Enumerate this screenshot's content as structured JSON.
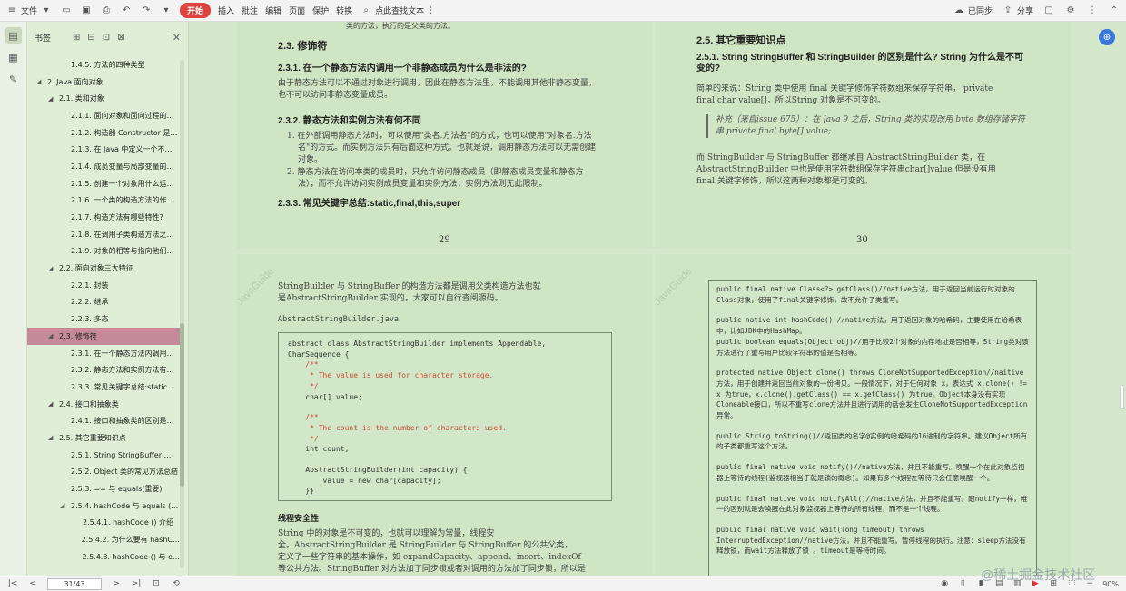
{
  "toolbar": {
    "file": "文件",
    "start": "开始",
    "menus": [
      "插入",
      "批注",
      "编辑",
      "页面",
      "保护",
      "转换"
    ],
    "search": "点此查找文本",
    "sync": "已同步",
    "share": "分享"
  },
  "panel": {
    "title": "书签",
    "items": [
      {
        "indent": 2,
        "arrow": "",
        "label": "1.4.5. 方法的四种类型"
      },
      {
        "indent": 0,
        "arrow": "◢",
        "label": "2. Java 面向对象"
      },
      {
        "indent": 1,
        "arrow": "◢",
        "label": "2.1. 类和对象"
      },
      {
        "indent": 2,
        "arrow": "",
        "label": "2.1.1. 面向对象和面向过程的…"
      },
      {
        "indent": 2,
        "arrow": "",
        "label": "2.1.2. 构造器 Constructor 是…"
      },
      {
        "indent": 2,
        "arrow": "",
        "label": "2.1.3. 在 Java 中定义一个不…"
      },
      {
        "indent": 2,
        "arrow": "",
        "label": "2.1.4. 成员变量与局部变量的…"
      },
      {
        "indent": 2,
        "arrow": "",
        "label": "2.1.5. 创建一个对象用什么运…"
      },
      {
        "indent": 2,
        "arrow": "",
        "label": "2.1.6. 一个类的构造方法的作…"
      },
      {
        "indent": 2,
        "arrow": "",
        "label": "2.1.7. 构造方法有哪些特性?"
      },
      {
        "indent": 2,
        "arrow": "",
        "label": "2.1.8. 在调用子类构造方法之…"
      },
      {
        "indent": 2,
        "arrow": "",
        "label": "2.1.9. 对象的相等与指向他们…"
      },
      {
        "indent": 1,
        "arrow": "◢",
        "label": "2.2. 面向对象三大特征"
      },
      {
        "indent": 2,
        "arrow": "",
        "label": "2.2.1. 封装"
      },
      {
        "indent": 2,
        "arrow": "",
        "label": "2.2.2. 继承"
      },
      {
        "indent": 2,
        "arrow": "",
        "label": "2.2.3. 多态"
      },
      {
        "indent": 1,
        "arrow": "◢",
        "label": "2.3. 修饰符",
        "selected": true
      },
      {
        "indent": 2,
        "arrow": "",
        "label": "2.3.1. 在一个静态方法内调用…"
      },
      {
        "indent": 2,
        "arrow": "",
        "label": "2.3.2. 静态方法和实例方法有…"
      },
      {
        "indent": 2,
        "arrow": "",
        "label": "2.3.3. 常见关键字总结:static…"
      },
      {
        "indent": 1,
        "arrow": "◢",
        "label": "2.4. 接口和抽象类"
      },
      {
        "indent": 2,
        "arrow": "",
        "label": "2.4.1. 接口和抽象类的区别是…"
      },
      {
        "indent": 1,
        "arrow": "◢",
        "label": "2.5. 其它重要知识点"
      },
      {
        "indent": 2,
        "arrow": "",
        "label": "2.5.1. String StringBuffer …"
      },
      {
        "indent": 2,
        "arrow": "",
        "label": "2.5.2. Object 类的常见方法总结"
      },
      {
        "indent": 2,
        "arrow": "",
        "label": "2.5.3. == 与 equals(重要)"
      },
      {
        "indent": 2,
        "arrow": "◢",
        "label": "2.5.4. hashCode 与 equals (…"
      },
      {
        "indent": 3,
        "arrow": "",
        "label": "2.5.4.1. hashCode () 介绍"
      },
      {
        "indent": 3,
        "arrow": "",
        "label": "2.5.4.2. 为什么要有 hashC…"
      },
      {
        "indent": 3,
        "arrow": "",
        "label": "2.5.4.3. hashCode () 与 e…"
      }
    ]
  },
  "page29": {
    "top_cut": "类的方法，执行的是父类的方法。",
    "h_23": "2.3. 修饰符",
    "h_231": "2.3.1. 在一个静态方法内调用一个非静态成员为什么是非法的?",
    "p_231": [
      "由于静态方法可以不通过对象进行调用，因此在静态方法里，不能调用其他非静态变量，",
      "也不可以访问非静态变量成员。"
    ],
    "h_232": "2.3.2. 静态方法和实例方法有何不同",
    "li1": [
      "在外部调用静态方法时，可以使用\"类名.方法名\"的方式，也可以使用\"对象名.方法",
      "名\"的方式。而实例方法只有后面这种方式。也就是说，调用静态方法可以无需创建",
      "对象。"
    ],
    "li2": [
      "静态方法在访问本类的成员时，只允许访问静态成员（即静态成员变量和静态方",
      "法），而不允许访问实例成员变量和实例方法；实例方法则无此限制。"
    ],
    "h_233": "2.3.3. 常见关键字总结:static,final,this,super",
    "num": "29"
  },
  "page30": {
    "h_25": "2.5. 其它重要知识点",
    "h_251": [
      "2.5.1. String StringBuffer 和 StringBuilder 的区别是什么? String 为什么是不可",
      "变的?"
    ],
    "p1": [
      "简单的来说：String 类中使用 final 关键字修饰字符数组来保存字符串， private",
      "final char value[]，所以String 对象是不可变的。"
    ],
    "quote": [
      "补充（来自issue 675）：在 Java 9 之后，String 类的实现改用 byte 数组存储字符",
      "串 private final byte[] value;"
    ],
    "p2": [
      "而 StringBuilder 与 StringBuffer 都继承自 AbstractStringBuilder 类，在",
      "AbstractStringBuilder 中也是使用字符数组保存字符串char[]value 但是没有用",
      "final 关键字修饰，所以这两种对象都是可变的。"
    ],
    "num": "30"
  },
  "page31": {
    "watermark": "JavaGuide",
    "p1": [
      "StringBuilder 与 StringBuffer 的构造方法都是调用父类构造方法也就",
      "是AbstractStringBuilder 实现的，大家可以自行查阅源码。"
    ],
    "file": "AbstractStringBuilder.java",
    "code": [
      "abstract class AbstractStringBuilder implements Appendable,",
      "CharSequence {",
      "    /**",
      "     * The value is used for character storage.",
      "     */",
      "    char[] value;",
      "",
      "    /**",
      "     * The count is the number of characters used.",
      "     */",
      "    int count;",
      "",
      "    AbstractStringBuilder(int capacity) {",
      "        value = new char[capacity];",
      "    }}"
    ],
    "h_safe": "线程安全性",
    "p2": [
      "String 中的对象是不可变的，也就可以理解为常量，线程安",
      "全。AbstractStringBuilder 是 StringBuilder 与 StringBuffer 的公共父类，",
      "定义了一些字符串的基本操作，如 expandCapacity、append、insert、indexOf",
      "等公共方法。StringBuffer 对方法加了同步锁或者对调用的方法加了同步锁，所以是"
    ]
  },
  "page32": {
    "watermark": "JavaGuide",
    "code": [
      "public final native Class<?> getClass()//native方法，用于返回当前运行时对象的Class对象，使用了final关键字修饰，故不允许子类重写。",
      "",
      "public native int hashCode() //native方法，用于返回对象的哈希码，主要使用在哈希表中，比如JDK中的HashMap。",
      "public boolean equals(Object obj)//用于比较2个对象的内存地址是否相等，String类对该方法进行了重写用户比较字符串的值是否相等。",
      "",
      "protected native Object clone() throws CloneNotSupportedException//naitive方法，用于创建并返回当前对象的一份拷贝。一般情况下，对于任何对象 x，表达式 x.clone() != x 为true，x.clone().getClass() == x.getClass() 为true。Object本身没有实现Cloneable接口，所以不重写clone方法并且进行调用的话会发生CloneNotSupportedException异常。",
      "",
      "public String toString()//返回类的名字@实例的哈希码的16进制的字符串。建议Object所有的子类都重写这个方法。",
      "",
      "public final native void notify()//native方法，并且不能重写。唤醒一个在此对象监视器上等待的线程(监视器相当于就是锁的概念)。如果有多个线程在等待只会任意唤醒一个。",
      "",
      "public final native void notifyAll()//native方法，并且不能重写。跟notify一样，唯一的区别就是会唤醒在此对象监视器上等待的所有线程，而不是一个线程。",
      "",
      "public final native void wait(long timeout) throws InterruptedException//native方法，并且不能重写。暂停线程的执行。注意：sleep方法没有释放锁，而wait方法释放了锁 。timeout是等待时间。"
    ]
  },
  "statusbar": {
    "page": "31/43",
    "zoom": "90%"
  },
  "brand": "@稀土掘金技术社区"
}
